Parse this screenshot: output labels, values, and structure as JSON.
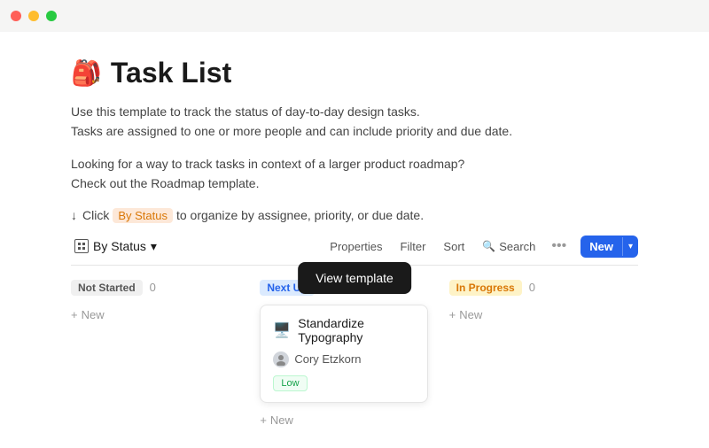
{
  "titlebar": {
    "lights": [
      "red",
      "yellow",
      "green"
    ]
  },
  "page": {
    "emoji": "🎒",
    "title": "Task List",
    "description_line1": "Use this template to track the status of day-to-day design tasks.",
    "description_line2": "Tasks are assigned to one or more people and can include priority and due date.",
    "roadmap_line1": "Looking for a way to track tasks in context of a larger product roadmap?",
    "roadmap_line2": "Check out the Roadmap template.",
    "click_hint_arrow": "↓",
    "click_hint_pre": "Click",
    "click_hint_highlight": "By Status",
    "click_hint_post": "to organize by assignee, priority, or due date."
  },
  "toolbar": {
    "by_status_label": "By Status",
    "properties_label": "Properties",
    "filter_label": "Filter",
    "sort_label": "Sort",
    "search_label": "Search",
    "dots_label": "•••",
    "new_label": "New",
    "chevron": "▾"
  },
  "tooltip": {
    "label": "View template"
  },
  "columns": [
    {
      "id": "not-started",
      "status": "Not Started",
      "badge_class": "badge-not-started",
      "count": "0",
      "add_label": "New",
      "tasks": []
    },
    {
      "id": "next-up",
      "status": "Next Up",
      "badge_class": "badge-next-up",
      "count": "1",
      "add_label": "New",
      "tasks": [
        {
          "icon": "🖥️",
          "title": "Standardize Typography",
          "assignee": "Cory Etzkorn",
          "priority": "Low"
        }
      ]
    },
    {
      "id": "in-progress",
      "status": "In Progress",
      "badge_class": "badge-in-progress",
      "count": "0",
      "add_label": "New",
      "tasks": []
    }
  ]
}
